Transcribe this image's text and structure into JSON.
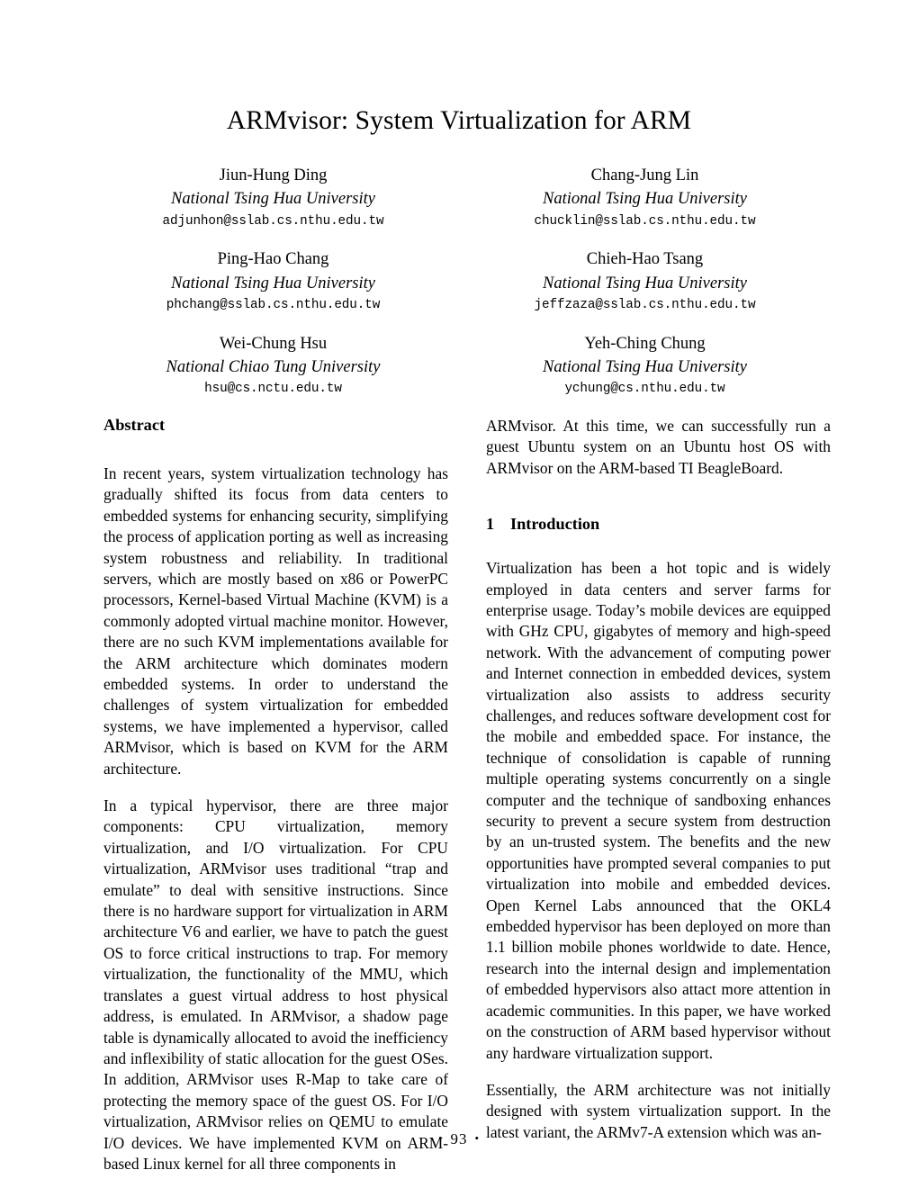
{
  "paper": {
    "title": "ARMvisor: System Virtualization for ARM",
    "authors": [
      {
        "name": "Jiun-Hung Ding",
        "affiliation": "National Tsing Hua University",
        "email": "adjunhon@sslab.cs.nthu.edu.tw"
      },
      {
        "name": "Chang-Jung Lin",
        "affiliation": "National Tsing Hua University",
        "email": "chucklin@sslab.cs.nthu.edu.tw"
      },
      {
        "name": "Ping-Hao Chang",
        "affiliation": "National Tsing Hua University",
        "email": "phchang@sslab.cs.nthu.edu.tw"
      },
      {
        "name": "Chieh-Hao Tsang",
        "affiliation": "National Tsing Hua University",
        "email": "jeffzaza@sslab.cs.nthu.edu.tw"
      },
      {
        "name": "Wei-Chung Hsu",
        "affiliation": "National Chiao Tung University",
        "email": "hsu@cs.nctu.edu.tw"
      },
      {
        "name": "Yeh-Ching Chung",
        "affiliation": "National Tsing Hua University",
        "email": "ychung@cs.nthu.edu.tw"
      }
    ],
    "abstract": {
      "heading": "Abstract",
      "paragraph_1": "In recent years, system virtualization technology has gradually shifted its focus from data centers to embedded systems for enhancing security, simplifying the process of application porting as well as increasing system robustness and reliability. In traditional servers, which are mostly based on x86 or PowerPC processors, Kernel-based Virtual Machine (KVM) is a commonly adopted virtual machine monitor. However, there are no such KVM implementations available for the ARM architecture which dominates modern embedded systems. In order to understand the challenges of system virtualization for embedded systems, we have implemented a hypervisor, called ARMvisor, which is based on KVM for the ARM architecture.",
      "paragraph_2": "In a typical hypervisor, there are three major components: CPU virtualization, memory virtualization, and I/O virtualization. For CPU virtualization, ARMvisor uses traditional “trap and emulate” to deal with sensitive instructions. Since there is no hardware support for virtualization in ARM architecture V6 and earlier, we have to patch the guest OS to force critical instructions to trap. For memory virtualization, the functionality of the MMU, which translates a guest virtual address to host physical address, is emulated. In ARMvisor, a shadow page table is dynamically allocated to avoid the inefficiency and inflexibility of static allocation for the guest OSes. In addition, ARMvisor uses R-Map to take care of protecting the memory space of the guest OS. For I/O virtualization, ARMvisor relies on QEMU to emulate I/O devices. We have implemented KVM on ARM-based Linux kernel for all three components in ARMvisor. At this time, we can successfully run a guest Ubuntu system on an Ubuntu host OS with ARMvisor on the ARM-based TI BeagleBoard."
    },
    "sections": [
      {
        "number": "1",
        "heading": "Introduction",
        "paragraph_1": "Virtualization has been a hot topic and is widely employed in data centers and server farms for enterprise usage. Today’s mobile devices are equipped with GHz CPU, gigabytes of memory and high-speed network. With the advancement of computing power and Internet connection in embedded devices, system virtualization also assists to address security challenges, and reduces software development cost for the mobile and embedded space. For instance, the technique of consolidation is capable of running multiple operating systems concurrently on a single computer and the technique of sandboxing enhances security to prevent a secure system from destruction by an un-trusted system. The benefits and the new opportunities have prompted several companies to put virtualization into mobile and embedded devices. Open Kernel Labs announced that the OKL4 embedded hypervisor has been deployed on more than 1.1 billion mobile phones worldwide to date. Hence, research into the internal design and implementation of embedded hypervisors also attact more attention in academic communities. In this paper, we have worked on the construction of ARM based hypervisor without any hardware virtualization support.",
        "paragraph_2": "Essentially, the ARM architecture was not initially designed with system virtualization support. In the latest variant, the ARMv7-A extension which was an-"
      }
    ],
    "footer": {
      "left_dot": "•",
      "page_number": "93",
      "right_dot": "•"
    },
    "column_split": {
      "abstract_left_part": "In recent years, system virtualization technology has gradually shifted its focus from data centers to embedded systems for enhancing security, simplifying the process of application porting as well as increasing system robustness and reliability. In traditional servers, which are mostly based on x86 or PowerPC processors, Kernel-based Virtual Machine (KVM) is a commonly adopted virtual machine monitor. However, there are no such KVM implementations available for the ARM architecture which dominates modern embedded systems. In order to understand the challenges of system virtualization for embedded systems, we have implemented a hypervisor, called ARMvisor, which is based on KVM for the ARM architecture.",
      "abstract_p2_left_part": "In a typical hypervisor, there are three major components: CPU virtualization, memory virtualization, and I/O virtualization. For CPU virtualization, ARMvisor uses traditional “trap and emulate” to deal with sensitive instructions. Since there is no hardware support for virtualization in ARM architecture V6 and earlier, we have to patch the guest OS to force critical instructions to trap. For memory virtualization, the functionality of the MMU, which translates a guest virtual address to host physical address, is emulated. In ARMvisor, a shadow page table is dynamically allocated to avoid the inefficiency and inflexibility of static allocation for the guest OSes. In addition, ARMvisor uses R-Map to take care of protecting the memory space of the guest OS. For I/O virtualization, ARMvisor relies on QEMU to emulate I/O devices. We have implemented KVM on ARM-based Linux kernel for all three components in",
      "abstract_p2_right_part": "ARMvisor. At this time, we can successfully run a guest Ubuntu system on an Ubuntu host OS with ARMvisor on the ARM-based TI BeagleBoard."
    }
  }
}
